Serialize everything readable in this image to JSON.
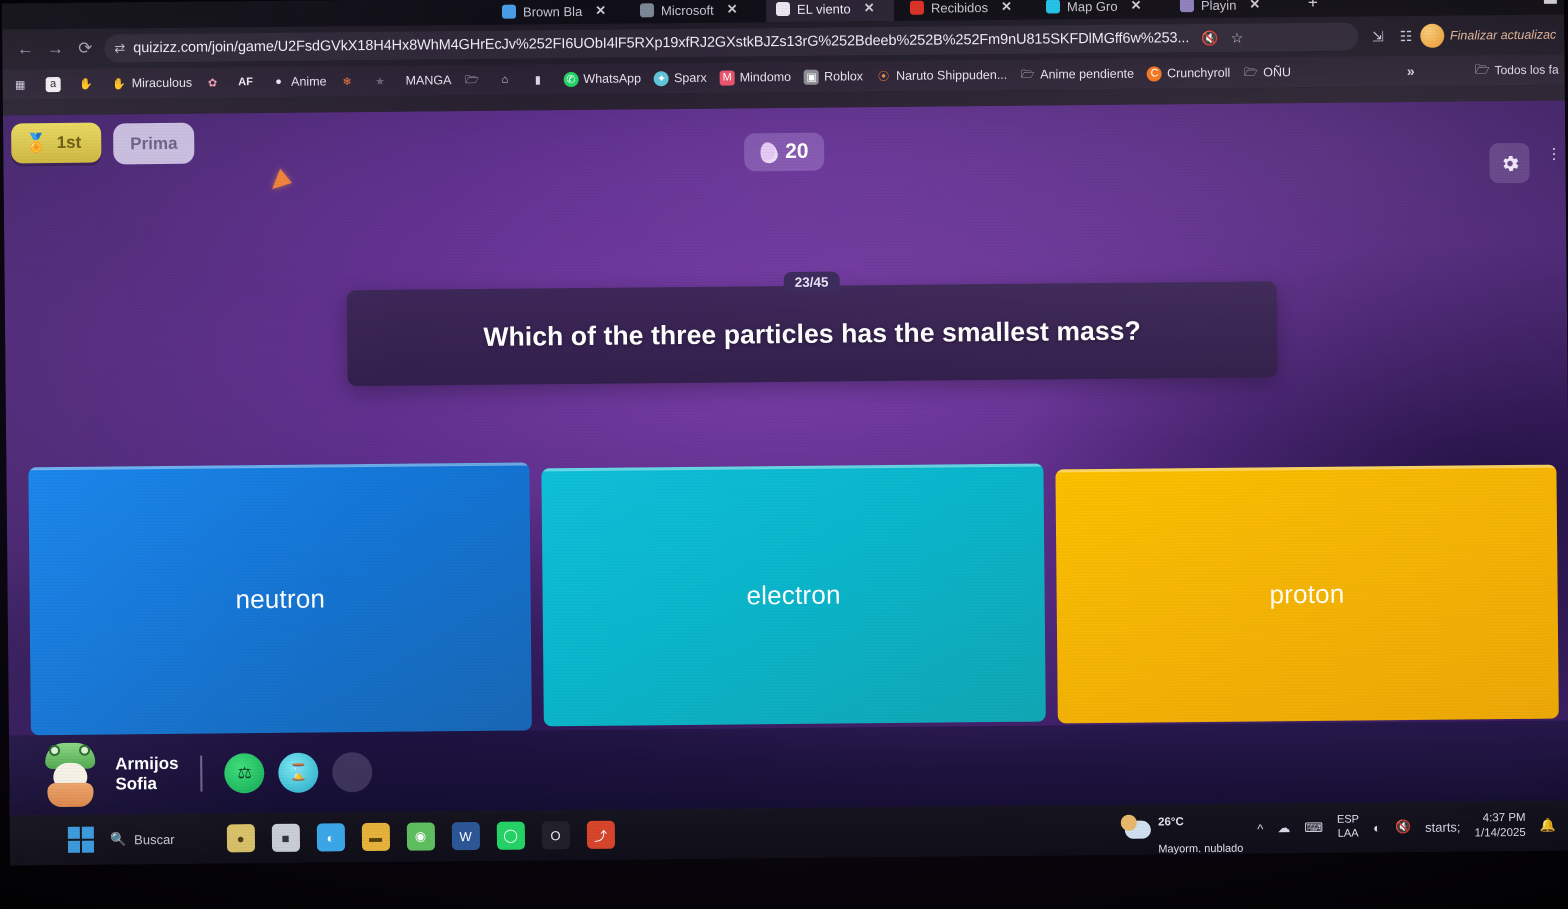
{
  "browser": {
    "tabs": [
      {
        "label": "Brown Bla",
        "favicon_color": "#4a9de8"
      },
      {
        "label": "Microsoft",
        "favicon_color": "#7c8896"
      },
      {
        "label": "EL viento",
        "favicon_color": "#e9e6f0"
      },
      {
        "label": "Recibidos",
        "favicon_color": "#d93025"
      },
      {
        "label": "Map Gro",
        "favicon_color": "#22c1e8"
      },
      {
        "label": "Playin",
        "favicon_color": "#8e7fbe"
      }
    ],
    "tab_close_label": "✕",
    "new_tab_label": "+",
    "window_minimize": "—",
    "window_restore": "⬜",
    "nav": {
      "back": "←",
      "forward": "→",
      "reload": "⟳"
    },
    "url": "quizizz.com/join/game/U2FsdGVkX18H4Hx8WhM4GHrEcJv%252FI6UObI4lF5RXp19xfRJ2GXstkBJZs13rG%252Bdeeb%252B%252Fm9nU815SKFDlMGff6w%253...",
    "site_settings_icon": "tune-icon",
    "omnibox_actions": [
      "media-muted-icon",
      "bookmark-star-icon"
    ],
    "toolbar_actions": [
      "share-icon",
      "extensions-icon"
    ],
    "profile_badge": "profile-avatar",
    "update_label": "Finalizar actualizac",
    "bookmarks": [
      {
        "label": "",
        "icon": "apps-grid-icon",
        "icon_color": "#d8d3e4"
      },
      {
        "label": "",
        "icon": "amazon-icon",
        "icon_color": "#f2f0f6"
      },
      {
        "label": "",
        "icon": "hand-icon",
        "icon_color": "#e2a38a"
      },
      {
        "label": "Miraculous",
        "icon": "hand-icon",
        "icon_color": "#e2a38a"
      },
      {
        "label": "",
        "icon": "bunny-icon",
        "icon_color": "#f1a0b4"
      },
      {
        "label": "",
        "icon": "af-icon",
        "icon_color": "#efeaf6"
      },
      {
        "label": "Anime",
        "icon": "circle-icon",
        "icon_color": "#e9e4f2"
      },
      {
        "label": "",
        "icon": "flower-icon",
        "icon_color": "#f07a3a"
      },
      {
        "label": "",
        "icon": "spider-icon",
        "icon_color": "#6d6478"
      },
      {
        "label": "MANGA",
        "icon": "",
        "icon_color": "#ffffff"
      },
      {
        "label": "",
        "icon": "folder-icon",
        "icon_color": "#e5e0ee"
      },
      {
        "label": "",
        "icon": "bottle-icon",
        "icon_color": "#ded8ea"
      },
      {
        "label": "",
        "icon": "battery-icon",
        "icon_color": "#ded8ea"
      },
      {
        "label": "WhatsApp",
        "icon": "whatsapp-icon",
        "icon_color": "#25d366"
      },
      {
        "label": "Sparx",
        "icon": "sparx-icon",
        "icon_color": "#5fc6d8"
      },
      {
        "label": "Mindomo",
        "icon": "mindomo-icon",
        "icon_color": "#e8556d"
      },
      {
        "label": "Roblox",
        "icon": "roblox-icon",
        "icon_color": "#8d8d94"
      },
      {
        "label": "Naruto Shippuden...",
        "icon": "naruto-icon",
        "icon_color": "#e08a4c"
      },
      {
        "label": "Anime pendiente",
        "icon": "folder-icon",
        "icon_color": "#e5e0ee"
      },
      {
        "label": "Crunchyroll",
        "icon": "crunchyroll-icon",
        "icon_color": "#f47521"
      },
      {
        "label": "OÑU",
        "icon": "folder-icon",
        "icon_color": "#e5e0ee"
      }
    ],
    "bookmarks_overflow": "»",
    "bookmarks_all_label": "Todos los fa",
    "bookmarks_all_icon": "folder-icon"
  },
  "quiz": {
    "rank": {
      "label": "1st",
      "icon": "medal-icon"
    },
    "team_label": "Prima",
    "streak": {
      "value": "20",
      "icon": "streak-drop-icon"
    },
    "settings_icon": "gear-icon",
    "menu_icon": "more-vertical-icon",
    "counter": "23/45",
    "question": "Which of the three particles has the smallest mass?",
    "answers": [
      {
        "label": "neutron",
        "color": "#1584ec"
      },
      {
        "label": "electron",
        "color": "#0fc0d9"
      },
      {
        "label": "proton",
        "color": "#fcc100"
      }
    ],
    "player": {
      "name": "Armijos\nSofia",
      "avatar_icon": "frog-avatar-icon",
      "powerups": [
        {
          "icon": "powerup-green-icon"
        },
        {
          "icon": "powerup-hourglass-icon"
        },
        {
          "icon": "powerup-empty-icon"
        }
      ]
    }
  },
  "taskbar": {
    "start_icon": "windows-start-icon",
    "search_label": "Buscar",
    "search_icon": "search-icon",
    "apps": [
      {
        "name": "meet-icon",
        "color": "#d9c269",
        "glyph": "●"
      },
      {
        "name": "explorer-icon",
        "color": "#c9cdd4",
        "glyph": "■"
      },
      {
        "name": "edge-icon",
        "color": "#3ba7e8",
        "glyph": "◐"
      },
      {
        "name": "file-explorer-icon",
        "color": "#e5b23c",
        "glyph": "▬"
      },
      {
        "name": "chrome-icon",
        "color": "#5fbf5f",
        "glyph": "◉"
      },
      {
        "name": "word-icon",
        "color": "#2b5797",
        "glyph": "W"
      },
      {
        "name": "whatsapp-icon",
        "color": "#25d366",
        "glyph": "◯"
      },
      {
        "name": "opera-icon",
        "color": "#e8e4ee",
        "glyph": "O"
      },
      {
        "name": "acrobat-icon",
        "color": "#d6452c",
        "glyph": "⤴"
      }
    ],
    "weather": {
      "temp": "26°C",
      "condition": "Mayorm. nublado",
      "icon": "partly-cloudy-icon"
    },
    "tray_chevron": "^",
    "tray_icons": [
      "cloud-sync-icon",
      "keyboard-icon",
      "wifi-icon",
      "volume-muted-icon",
      "battery-icon",
      "notification-bell-icon"
    ],
    "language": "ESP\nLAA",
    "clock": "4:37 PM\n1/14/2025"
  }
}
